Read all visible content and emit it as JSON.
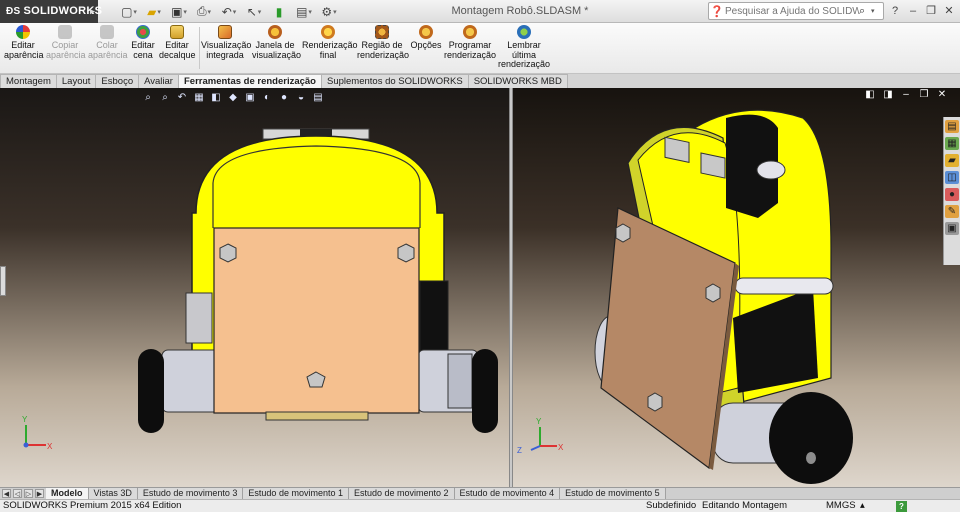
{
  "app": {
    "brand": "SOLIDWORKS",
    "document_title": "Montagem Robô.SLDASM *",
    "search_placeholder": "Pesquisar a Ajuda do SOLIDWORKS"
  },
  "ribbon": {
    "buttons": [
      {
        "label1": "Editar",
        "label2": "aparência",
        "label3": "",
        "icon": "appearance-ball-icon"
      },
      {
        "label1": "Copiar",
        "label2": "aparência",
        "label3": "",
        "icon": "copy-appearance-icon"
      },
      {
        "label1": "Colar",
        "label2": "aparência",
        "label3": "",
        "icon": "paste-appearance-icon"
      },
      {
        "label1": "Editar",
        "label2": "cena",
        "label3": "",
        "icon": "scene-icon"
      },
      {
        "label1": "Editar",
        "label2": "decalque",
        "label3": "",
        "icon": "decal-icon"
      },
      {
        "label1": "Visualização",
        "label2": "integrada",
        "label3": "",
        "icon": "integrated-preview-icon"
      },
      {
        "label1": "Janela de",
        "label2": "visualização",
        "label3": "",
        "icon": "preview-window-icon"
      },
      {
        "label1": "Renderização",
        "label2": "final",
        "label3": "",
        "icon": "final-render-icon"
      },
      {
        "label1": "Região de",
        "label2": "renderização",
        "label3": "",
        "icon": "render-region-icon"
      },
      {
        "label1": "Opções",
        "label2": "",
        "label3": "",
        "icon": "options-icon"
      },
      {
        "label1": "Programar",
        "label2": "renderização",
        "label3": "",
        "icon": "schedule-render-icon"
      },
      {
        "label1": "Lembrar",
        "label2": "última",
        "label3": "renderização",
        "icon": "recall-render-icon"
      }
    ]
  },
  "command_tabs": [
    {
      "label": "Montagem"
    },
    {
      "label": "Layout"
    },
    {
      "label": "Esboço"
    },
    {
      "label": "Avaliar"
    },
    {
      "label": "Ferramentas de renderização"
    },
    {
      "label": "Suplementos do SOLIDWORKS"
    },
    {
      "label": "SOLIDWORKS MBD"
    }
  ],
  "bottom_tabs": [
    {
      "label": "Modelo"
    },
    {
      "label": "Vistas 3D"
    },
    {
      "label": "Estudo de movimento 3"
    },
    {
      "label": "Estudo de movimento 1"
    },
    {
      "label": "Estudo de movimento 2"
    },
    {
      "label": "Estudo de movimento 4"
    },
    {
      "label": "Estudo de movimento 5"
    }
  ],
  "axes": {
    "x": "X",
    "y": "Y",
    "z": "Z"
  },
  "status_bar": {
    "edition": "SOLIDWORKS Premium 2015 x64 Edition",
    "state": "Subdefinido",
    "mode": "Editando Montagem",
    "units": "MMGS"
  },
  "colors": {
    "robot_yellow": "#ffff00",
    "panel_peach": "#f5c08f",
    "board_brown": "#b58866",
    "wheel_black": "#0d0d0d"
  }
}
